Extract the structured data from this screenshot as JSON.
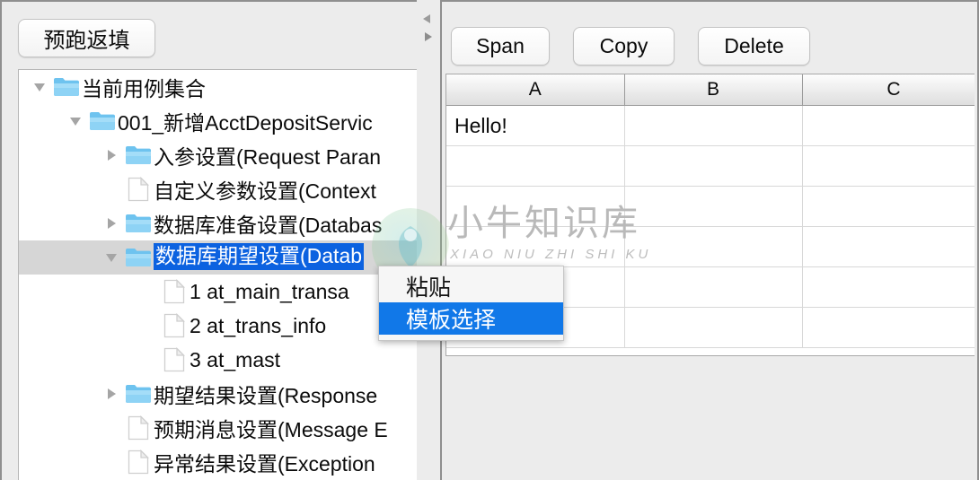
{
  "left_panel": {
    "prefill_button_label": "预跑返填",
    "tree": [
      {
        "label": "当前用例集合",
        "indent": 0,
        "icon": "folder-icon",
        "twisty": "expanded",
        "selected": false
      },
      {
        "label": "001_新增AcctDepositServic",
        "indent": 1,
        "icon": "folder-icon",
        "twisty": "expanded",
        "selected": false
      },
      {
        "label": "入参设置(Request Paran",
        "indent": 2,
        "icon": "folder-icon",
        "twisty": "collapsed",
        "selected": false
      },
      {
        "label": "自定义参数设置(Context",
        "indent": 2,
        "icon": "file-icon",
        "twisty": "none",
        "selected": false
      },
      {
        "label": "数据库准备设置(Databas",
        "indent": 2,
        "icon": "folder-icon",
        "twisty": "collapsed",
        "selected": false
      },
      {
        "label": "数据库期望设置(Datab",
        "indent": 2,
        "icon": "folder-icon",
        "twisty": "expanded",
        "selected": true
      },
      {
        "label": "1 at_main_transa",
        "indent": 3,
        "icon": "file-icon",
        "twisty": "none",
        "selected": false
      },
      {
        "label": "2 at_trans_info",
        "indent": 3,
        "icon": "file-icon",
        "twisty": "none",
        "selected": false
      },
      {
        "label": "3 at_mast",
        "indent": 3,
        "icon": "file-icon",
        "twisty": "none",
        "selected": false
      },
      {
        "label": "期望结果设置(Response",
        "indent": 2,
        "icon": "folder-icon",
        "twisty": "collapsed",
        "selected": false
      },
      {
        "label": "预期消息设置(Message E",
        "indent": 2,
        "icon": "file-icon",
        "twisty": "none",
        "selected": false
      },
      {
        "label": "异常结果设置(Exception",
        "indent": 2,
        "icon": "file-icon",
        "twisty": "none",
        "selected": false
      }
    ]
  },
  "splitter": {
    "collapse_left_icon": "triangle-left-icon",
    "collapse_right_icon": "triangle-right-icon"
  },
  "right_panel": {
    "toolbar": {
      "span_label": "Span",
      "copy_label": "Copy",
      "delete_label": "Delete"
    },
    "sheet": {
      "columns": [
        "A",
        "B",
        "C"
      ],
      "rows": [
        [
          "Hello!",
          "",
          ""
        ],
        [
          "",
          "",
          ""
        ],
        [
          "",
          "",
          ""
        ],
        [
          "",
          "",
          ""
        ],
        [
          "",
          "",
          ""
        ],
        [
          "",
          "",
          ""
        ]
      ]
    }
  },
  "context_menu": {
    "items": [
      {
        "label": "粘贴",
        "active": false
      },
      {
        "label": "模板选择",
        "active": true
      }
    ]
  },
  "watermark": {
    "chinese": "小牛知识库",
    "pinyin": "XIAO NIU ZHI SHI KU"
  },
  "colors": {
    "selection_blue": "#0c62e0",
    "menu_highlight_blue": "#1178e8",
    "row_selection_gray": "#d6d6d6",
    "folder_blue": "#79ccf2",
    "panel_gray": "#ececec"
  }
}
